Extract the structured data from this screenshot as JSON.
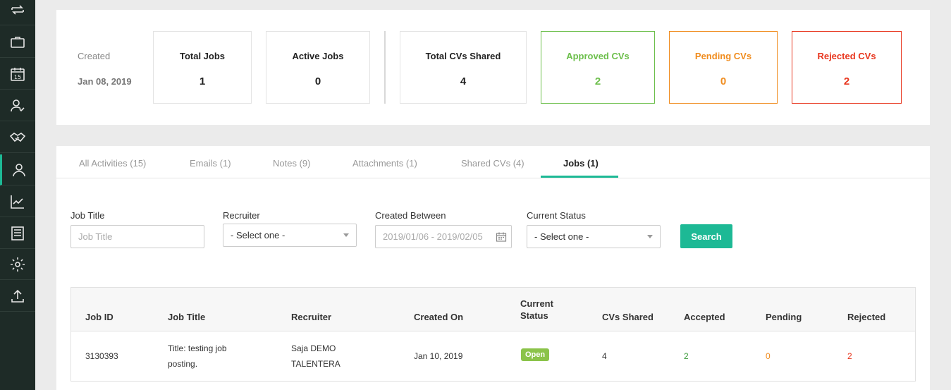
{
  "sidebar": {
    "items": [
      {
        "icon": "repeat-icon"
      },
      {
        "icon": "briefcase-icon"
      },
      {
        "icon": "calendar-icon",
        "text": "15"
      },
      {
        "icon": "user-check-icon"
      },
      {
        "icon": "handshake-icon"
      },
      {
        "icon": "users-icon",
        "active": true
      },
      {
        "icon": "chart-line-icon"
      },
      {
        "icon": "document-icon"
      },
      {
        "icon": "gear-icon"
      },
      {
        "icon": "upload-icon"
      }
    ],
    "accent": "#1db995"
  },
  "summary": {
    "created_label": "Created",
    "created_date": "Jan 08, 2019",
    "stats": [
      {
        "label": "Total Jobs",
        "value": "1",
        "color": "#222222"
      },
      {
        "label": "Active Jobs",
        "value": "0",
        "color": "#222222"
      },
      {
        "label": "Total CVs Shared",
        "value": "4",
        "color": "#222222"
      },
      {
        "label": "Approved CVs",
        "value": "2",
        "color": "#6cbf4b"
      },
      {
        "label": "Pending CVs",
        "value": "0",
        "color": "#f08c1e"
      },
      {
        "label": "Rejected CVs",
        "value": "2",
        "color": "#e8361e"
      }
    ]
  },
  "tabs": [
    {
      "label": "All Activities",
      "count": "(15)"
    },
    {
      "label": "Emails",
      "count": "(1)"
    },
    {
      "label": "Notes",
      "count": "(9)"
    },
    {
      "label": "Attachments",
      "count": "(1)"
    },
    {
      "label": "Shared CVs",
      "count": "(4)"
    },
    {
      "label": "Jobs",
      "count": "(1)",
      "active": true
    }
  ],
  "filters": {
    "job_title_label": "Job Title",
    "job_title_placeholder": "Job Title",
    "recruiter_label": "Recruiter",
    "recruiter_value": "- Select one -",
    "created_between_label": "Created Between",
    "created_between_value": "2019/01/06 - 2019/02/05",
    "status_label": "Current Status",
    "status_value": "- Select one -",
    "search_label": "Search"
  },
  "table": {
    "headers": [
      "Job ID",
      "Job Title",
      "Recruiter",
      "Created On",
      "Current Status",
      "CVs Shared",
      "Accepted",
      "Pending",
      "Rejected"
    ],
    "rows": [
      {
        "job_id": "3130393",
        "job_title": "Title: testing job posting.",
        "recruiter": "Saja DEMO TALENTERA",
        "created_on": "Jan 10, 2019",
        "status": "Open",
        "cvs_shared": "4",
        "accepted": "2",
        "pending": "0",
        "rejected": "2"
      }
    ],
    "colors": {
      "accepted": "#3a9a3a",
      "pending": "#f08c1e",
      "rejected": "#e8361e",
      "status_badge": "#8bc34a"
    }
  }
}
